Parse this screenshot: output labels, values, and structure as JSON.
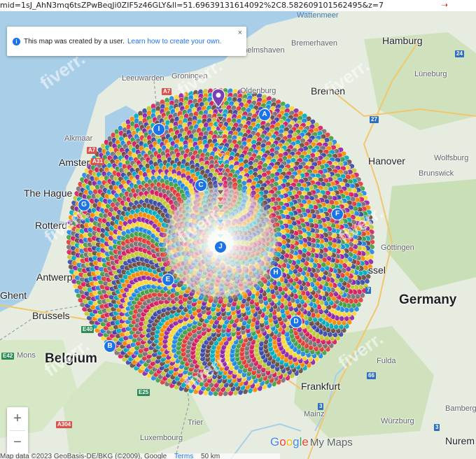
{
  "url_text": "mid=1sJ_AhN3mq6tsZPwBeqJi0ZIF5z46GLY&ll=51.69639131614092%2C8.582609101562495&z=7",
  "banner": {
    "text": "This map was created by a user.",
    "link": "Learn how to create your own.",
    "close": "×",
    "info_icon": "i"
  },
  "places": {
    "wattenmeer": "Wattenmeer",
    "hamburg": "Hamburg",
    "bremerhaven": "Bremerhaven",
    "wilhelmshaven": "Wilhelmshaven",
    "bremen": "Bremen",
    "lüneburg": "Lüneburg",
    "leeuwarden": "Leeuwarden",
    "groningen": "Groningen",
    "oldenburg": "Oldenburg",
    "alkmaar": "Alkmaar",
    "amsterdam": "Amster",
    "hague": "The Hague",
    "rotterdam": "Rotterd",
    "antwerp": "Antwerp",
    "ghent": "Ghent",
    "brussels": "Brussels",
    "belgium": "Belgium",
    "mons": "Mons",
    "hanover": "Hanover",
    "wolfsburg": "Wolfsburg",
    "brunswick": "Brunswick",
    "gottingen": "Göttingen",
    "kassel": "ssel",
    "germany": "Germany",
    "fulda": "Fulda",
    "frankfurt": "Frankfurt",
    "mainz": "Mainz",
    "trier": "Trier",
    "luxembourg": "Luxembourg",
    "wurzburg": "Würzburg",
    "bamberg": "Bamberg",
    "nuremberg": "Nurem"
  },
  "roads": [
    "A7",
    "A7",
    "A31",
    "E40",
    "E42",
    "E25",
    "A304",
    "E42",
    "27",
    "24",
    "1",
    "7",
    "66",
    "3",
    "3",
    "7",
    "4"
  ],
  "markers": [
    "A",
    "B",
    "C",
    "D",
    "E",
    "F",
    "G",
    "H",
    "I",
    "J"
  ],
  "zoom": {
    "in": "+",
    "out": "−"
  },
  "footer": {
    "attribution": "Map data ©2023 GeoBasis-DE/BKG (©2009), Google",
    "terms": "Terms",
    "scale": "50 km"
  },
  "logo": {
    "google": "Google",
    "mymaps": "My Maps"
  },
  "watermark": "fiverr.",
  "colors": {
    "accent": "#1a73e8",
    "land": "#e8eee0",
    "forest": "#c7dfb6",
    "water": "#a9cfe8",
    "pin_purple": "#7b3fb4"
  }
}
